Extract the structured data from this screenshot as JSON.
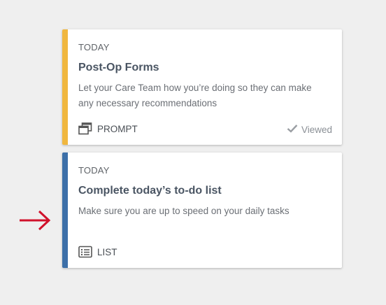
{
  "cards": [
    {
      "date": "TODAY",
      "title": "Post-Op Forms",
      "description": "Let your Care Team how you’re doing so they can make any necessary recommendations",
      "type_label": "PROMPT",
      "type_icon": "windows-icon",
      "status": "Viewed",
      "status_icon": "checkmark-icon",
      "accent_color": "#f0b73f"
    },
    {
      "date": "TODAY",
      "title": "Complete today’s to-do list",
      "description": "Make sure you are up to speed on your daily tasks",
      "type_label": "LIST",
      "type_icon": "list-icon",
      "accent_color": "#3c6fa8"
    }
  ],
  "pointer": {
    "icon": "right-arrow-icon",
    "color": "#d0112b"
  }
}
